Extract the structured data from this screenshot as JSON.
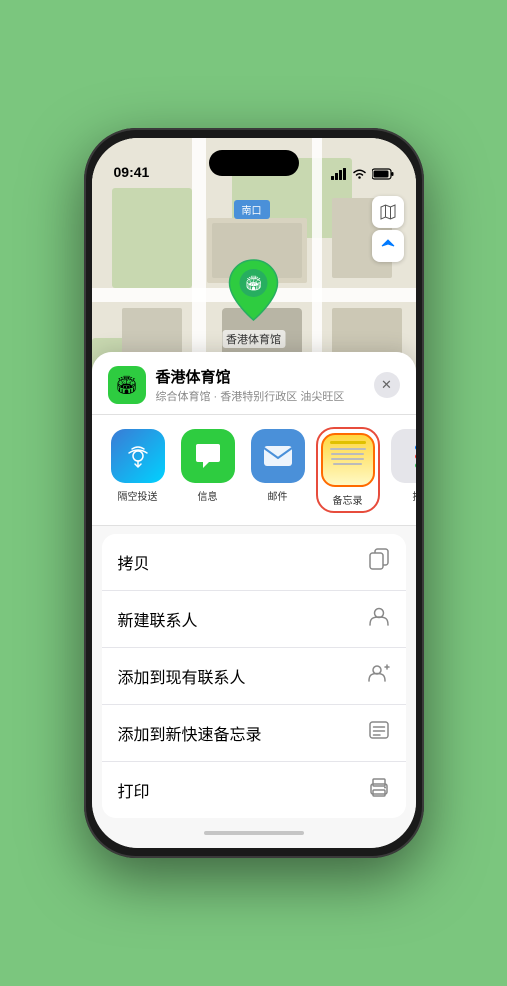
{
  "status_bar": {
    "time": "09:41",
    "signal": "●●●●",
    "wifi": "WiFi",
    "battery": "Battery"
  },
  "map": {
    "north_label": "南口",
    "map_btn_map": "🗺",
    "map_btn_location": "↗"
  },
  "pin": {
    "label": "香港体育馆",
    "icon": "🏟"
  },
  "sheet": {
    "venue_name": "香港体育馆",
    "venue_desc": "综合体育馆 · 香港特别行政区 油尖旺区",
    "close_icon": "✕"
  },
  "share_items": [
    {
      "id": "airdrop",
      "label": "隔空投送",
      "icon": "📡"
    },
    {
      "id": "messages",
      "label": "信息",
      "icon": "💬"
    },
    {
      "id": "mail",
      "label": "邮件",
      "icon": "✉"
    },
    {
      "id": "notes",
      "label": "备忘录",
      "icon": "notes"
    },
    {
      "id": "more",
      "label": "推",
      "icon": "more"
    }
  ],
  "actions": [
    {
      "id": "copy",
      "label": "拷贝",
      "icon": "⎘"
    },
    {
      "id": "new-contact",
      "label": "新建联系人",
      "icon": "👤"
    },
    {
      "id": "add-contact",
      "label": "添加到现有联系人",
      "icon": "👤+"
    },
    {
      "id": "quick-note",
      "label": "添加到新快速备忘录",
      "icon": "📝"
    },
    {
      "id": "print",
      "label": "打印",
      "icon": "🖨"
    }
  ]
}
